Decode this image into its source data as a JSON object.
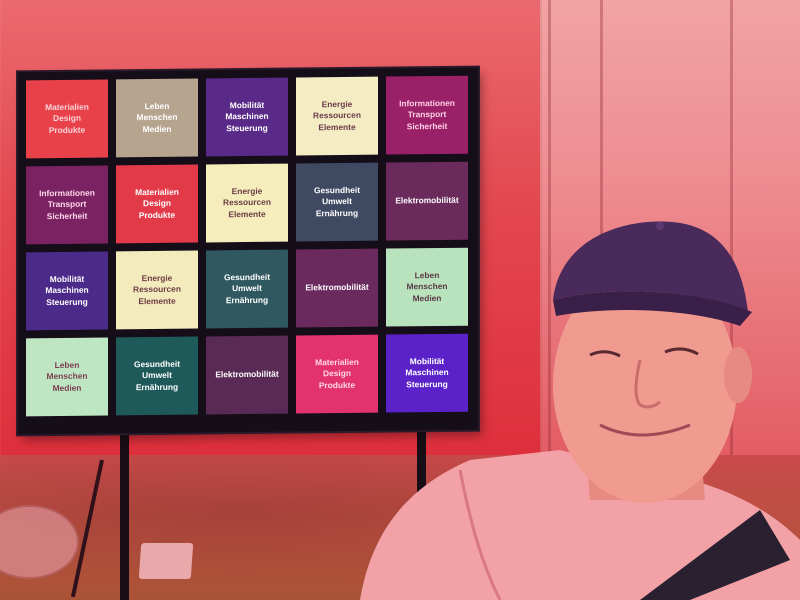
{
  "board": {
    "tiles": [
      {
        "lines": [
          "Materialien",
          "Design",
          "Produkte"
        ],
        "bg": "#e8414a",
        "fg": "#f7d2d8"
      },
      {
        "lines": [
          "Leben",
          "Menschen",
          "Medien"
        ],
        "bg": "#b6a48f",
        "fg": "#ffffff"
      },
      {
        "lines": [
          "Mobilität",
          "Maschinen",
          "Steuerung"
        ],
        "bg": "#5a2a88",
        "fg": "#ffffff"
      },
      {
        "lines": [
          "Energie",
          "Ressourcen",
          "Elemente"
        ],
        "bg": "#f4ecc3",
        "fg": "#6b3d4a"
      },
      {
        "lines": [
          "Informationen",
          "Transport",
          "Sicherheit"
        ],
        "bg": "#9a2068",
        "fg": "#ffd0e4"
      },
      {
        "lines": [
          "Informationen",
          "Transport",
          "Sicherheit"
        ],
        "bg": "#7a2262",
        "fg": "#ffd7ea"
      },
      {
        "lines": [
          "Materialien",
          "Design",
          "Produkte"
        ],
        "bg": "#e23a48",
        "fg": "#ffffff"
      },
      {
        "lines": [
          "Energie",
          "Ressourcen",
          "Elemente"
        ],
        "bg": "#f5eebc",
        "fg": "#6c3d45"
      },
      {
        "lines": [
          "Gesundheit",
          "Umwelt",
          "Ernährung"
        ],
        "bg": "#3f4a62",
        "fg": "#ffffff"
      },
      {
        "lines": [
          "Elektromobilität"
        ],
        "bg": "#6a2a5c",
        "fg": "#ffffff"
      },
      {
        "lines": [
          "Mobilität",
          "Maschinen",
          "Steuerung"
        ],
        "bg": "#4c2a8a",
        "fg": "#ffffff"
      },
      {
        "lines": [
          "Energie",
          "Ressourcen",
          "Elemente"
        ],
        "bg": "#f4ebbd",
        "fg": "#6c3d45"
      },
      {
        "lines": [
          "Gesundheit",
          "Umwelt",
          "Ernährung"
        ],
        "bg": "#2f5860",
        "fg": "#ffffff"
      },
      {
        "lines": [
          "Elektromobilität"
        ],
        "bg": "#6a2a5e",
        "fg": "#ffffff"
      },
      {
        "lines": [
          "Leben",
          "Menschen",
          "Medien"
        ],
        "bg": "#b9e3bd",
        "fg": "#5a3a48"
      },
      {
        "lines": [
          "Leben",
          "Menschen",
          "Medien"
        ],
        "bg": "#bfe6c2",
        "fg": "#7a3e52"
      },
      {
        "lines": [
          "Gesundheit",
          "Umwelt",
          "Ernährung"
        ],
        "bg": "#1f5a5a",
        "fg": "#ffffff"
      },
      {
        "lines": [
          "Elektromobilität"
        ],
        "bg": "#5a2a56",
        "fg": "#ffffff"
      },
      {
        "lines": [
          "Materialien",
          "Design",
          "Produkte"
        ],
        "bg": "#e2336f",
        "fg": "#ffd6e6"
      },
      {
        "lines": [
          "Mobilität",
          "Maschinen",
          "Steuerung"
        ],
        "bg": "#5a22c8",
        "fg": "#ffffff"
      }
    ]
  }
}
